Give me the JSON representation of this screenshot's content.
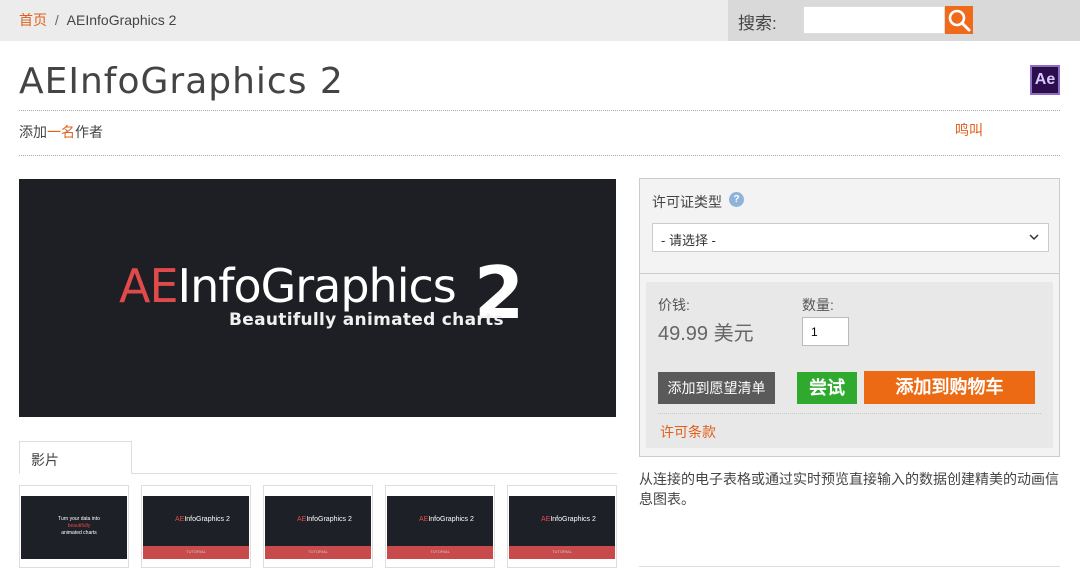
{
  "breadcrumb": {
    "home": "首页",
    "separator": "/",
    "current": "AEInfoGraphics 2"
  },
  "search": {
    "label": "搜索:",
    "value": "",
    "placeholder": ""
  },
  "product": {
    "title": "AEInfoGraphics 2",
    "app_badge": "Ae",
    "author_prefix": "添加",
    "author_highlight": "一名",
    "author_suffix": "作者",
    "honk_link": "鸣叫"
  },
  "hero": {
    "logo_ae": "AE",
    "logo_rest": "InfoGraphics",
    "logo_num": "2",
    "subtitle": "Beautifully animated charts"
  },
  "tabs": [
    {
      "label": "影片"
    }
  ],
  "thumbnails": [
    {
      "lines": [
        "Turn your data into",
        "beautifully",
        "animated charts"
      ],
      "kind": "intro"
    },
    {
      "logo_ae": "AE",
      "logo_rest": "InfoGraphics 2",
      "tag": "TUTORIAL",
      "kind": "tutorial"
    },
    {
      "logo_ae": "AE",
      "logo_rest": "InfoGraphics 2",
      "tag": "TUTORIAL",
      "kind": "tutorial"
    },
    {
      "logo_ae": "AE",
      "logo_rest": "InfoGraphics 2",
      "tag": "TUTORIAL",
      "kind": "tutorial"
    },
    {
      "logo_ae": "AE",
      "logo_rest": "InfoGraphics 2",
      "tag": "TUTORIAL",
      "kind": "tutorial"
    }
  ],
  "purchase": {
    "license_type_label": "许可证类型",
    "help_icon": "question-icon",
    "license_select_value": "- 请选择 -",
    "price_label": "价钱:",
    "price_value": "49.99",
    "price_currency": "美元",
    "qty_label": "数量:",
    "qty_value": "1",
    "wishlist_label": "添加到愿望清单",
    "try_label": "尝试",
    "add_to_cart_label": "添加到购物车",
    "license_terms_label": "许可条款"
  },
  "description": "从连接的电子表格或通过实时预览直接输入的数据创建精美的动画信息图表。",
  "colors": {
    "accent": "#e0601a",
    "cart": "#ec6a14",
    "try": "#2faa2f",
    "wishlist": "#5a5a5a"
  }
}
